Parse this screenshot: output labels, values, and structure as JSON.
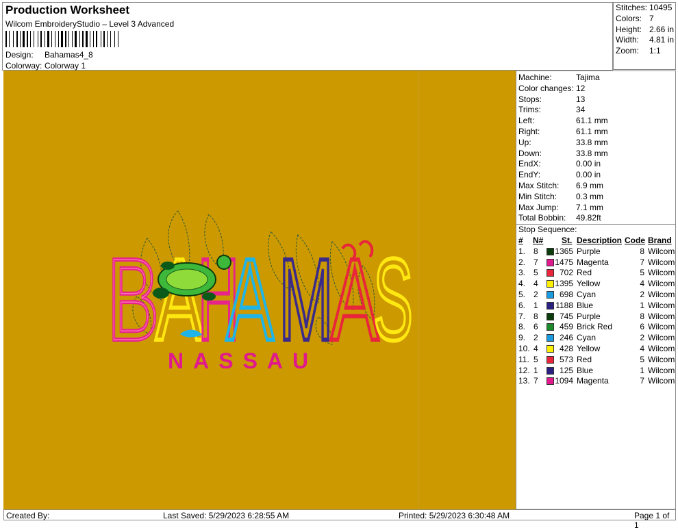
{
  "header": {
    "title": "Production Worksheet",
    "software": "Wilcom EmbroideryStudio – Level 3 Advanced",
    "design_label": "Design:",
    "design_value": "Bahamas4_8",
    "colorway_label": "Colorway:",
    "colorway_value": "Colorway 1"
  },
  "summary": [
    {
      "label": "Stitches:",
      "value": "10495"
    },
    {
      "label": "Colors:",
      "value": "7"
    },
    {
      "label": "Height:",
      "value": "2.66 in"
    },
    {
      "label": "Width:",
      "value": "4.81 in"
    },
    {
      "label": "Zoom:",
      "value": "1:1"
    }
  ],
  "machine_info": [
    {
      "label": "Machine:",
      "value": "Tajima"
    },
    {
      "label": "Color changes:",
      "value": "12"
    },
    {
      "label": "Stops:",
      "value": "13"
    },
    {
      "label": "Trims:",
      "value": "34"
    },
    {
      "label": "Left:",
      "value": "61.1 mm"
    },
    {
      "label": "Right:",
      "value": "61.1 mm"
    },
    {
      "label": "Up:",
      "value": "33.8 mm"
    },
    {
      "label": "Down:",
      "value": "33.8 mm"
    },
    {
      "label": "EndX:",
      "value": "0.00 in"
    },
    {
      "label": "EndY:",
      "value": "0.00 in"
    },
    {
      "label": "Max Stitch:",
      "value": "6.9 mm"
    },
    {
      "label": "Min Stitch:",
      "value": "0.3 mm"
    },
    {
      "label": "Max Jump:",
      "value": "7.1 mm"
    },
    {
      "label": "Total Bobbin:",
      "value": "49.82ft"
    }
  ],
  "stop_sequence": {
    "title": "Stop Sequence:",
    "columns": [
      "#",
      "N#",
      "St.",
      "Description",
      "Code",
      "Brand"
    ],
    "rows": [
      {
        "num": "1.",
        "n": "8",
        "color": "#0b3b0b",
        "st": "1365",
        "desc": "Purple",
        "code": "8",
        "brand": "Wilcom"
      },
      {
        "num": "2.",
        "n": "7",
        "color": "#e0198c",
        "st": "1475",
        "desc": "Magenta",
        "code": "7",
        "brand": "Wilcom"
      },
      {
        "num": "3.",
        "n": "5",
        "color": "#e8253a",
        "st": "702",
        "desc": "Red",
        "code": "5",
        "brand": "Wilcom"
      },
      {
        "num": "4.",
        "n": "4",
        "color": "#ffef00",
        "st": "1395",
        "desc": "Yellow",
        "code": "4",
        "brand": "Wilcom"
      },
      {
        "num": "5.",
        "n": "2",
        "color": "#1a9be0",
        "st": "698",
        "desc": "Cyan",
        "code": "2",
        "brand": "Wilcom"
      },
      {
        "num": "6.",
        "n": "1",
        "color": "#2a2080",
        "st": "1188",
        "desc": "Blue",
        "code": "1",
        "brand": "Wilcom"
      },
      {
        "num": "7.",
        "n": "8",
        "color": "#0b3b0b",
        "st": "745",
        "desc": "Purple",
        "code": "8",
        "brand": "Wilcom"
      },
      {
        "num": "8.",
        "n": "6",
        "color": "#1a8a2a",
        "st": "459",
        "desc": "Brick Red",
        "code": "6",
        "brand": "Wilcom"
      },
      {
        "num": "9.",
        "n": "2",
        "color": "#1a9be0",
        "st": "246",
        "desc": "Cyan",
        "code": "2",
        "brand": "Wilcom"
      },
      {
        "num": "10.",
        "n": "4",
        "color": "#ffef00",
        "st": "428",
        "desc": "Yellow",
        "code": "4",
        "brand": "Wilcom"
      },
      {
        "num": "11.",
        "n": "5",
        "color": "#e8253a",
        "st": "573",
        "desc": "Red",
        "code": "5",
        "brand": "Wilcom"
      },
      {
        "num": "12.",
        "n": "1",
        "color": "#2a2080",
        "st": "125",
        "desc": "Blue",
        "code": "1",
        "brand": "Wilcom"
      },
      {
        "num": "13.",
        "n": "7",
        "color": "#e0198c",
        "st": "1094",
        "desc": "Magenta",
        "code": "7",
        "brand": "Wilcom"
      }
    ]
  },
  "design": {
    "main_text": "BAHAMAS",
    "sub_text": "NASSAU",
    "background": "#CC9900"
  },
  "footer": {
    "created_by": "Created By:",
    "last_saved": "Last Saved: 5/29/2023 6:28:55 AM",
    "printed": "Printed: 5/29/2023 6:30:48 AM",
    "page": "Page 1 of 1"
  }
}
